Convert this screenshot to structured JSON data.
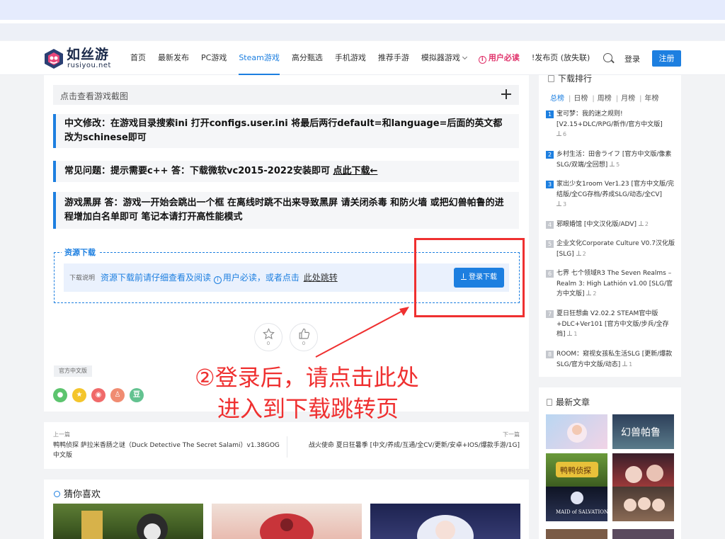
{
  "site": {
    "logo_text": "如丝游",
    "logo_sub": "rusiyou.net"
  },
  "nav": {
    "items": [
      "首页",
      "最新发布",
      "PC游戏",
      "Steam游戏",
      "高分甄选",
      "手机游戏",
      "推荐手游",
      "模拟器游戏"
    ],
    "active_index": 3,
    "notice": "用户必读",
    "publish": "!发布页 (放失联)",
    "login": "登录",
    "register": "注册"
  },
  "main": {
    "screenshot_toggle": "点击查看游戏截图",
    "notes": [
      {
        "text": "中文修改：在游戏目录搜索ini 打开configs.user.ini 将最后两行default=和language=后面的英文都改为schinese即可",
        "link": ""
      },
      {
        "text": "常见问题：提示需要c++ 答：下载微软vc2015-2022安装即可 ",
        "link": "点此下载←"
      },
      {
        "text": "游戏黑屏 答：游戏一开始会跳出一个框 在离线时跳不出来导致黑屏 请关闭杀毒 和防火墙 或把幻兽帕鲁的进程增加白名单即可 笔记本请打开高性能模式",
        "link": ""
      }
    ],
    "resource": {
      "title": "资源下载",
      "label": "下载说明",
      "text_before": "资源下载前请仔细查看及阅读",
      "notice": "用户必读",
      "text_after": "，或者点击",
      "link": "此处跳转",
      "button": "登录下载"
    },
    "reactions": {
      "star_count": "0",
      "like_count": "0"
    },
    "tag": "官方中文版",
    "share_icons": [
      "wechat-icon",
      "qzone-icon",
      "weibo-icon",
      "qq-icon",
      "douban-icon"
    ],
    "share_douban": "豆"
  },
  "annotation": {
    "line1": "②登录后，请点击此处",
    "line2": "进入到下载跳转页"
  },
  "prev_next": {
    "prev_label": "上一篇",
    "prev_title": "鸭鸭侦探 萨拉米香肠之谜（Duck Detective The Secret Salami）v1.38GOG中文版",
    "next_label": "下一篇",
    "next_title": "战火使命 夏日狂暑季 [中文/养成/互通/全CV/更新/安卓+IOS/爆款手游/1G]"
  },
  "guess": {
    "title": "猜你喜欢"
  },
  "rank": {
    "title": "下载排行",
    "tabs": [
      "总榜",
      "日榜",
      "周榜",
      "月榜",
      "年榜"
    ],
    "items": [
      {
        "num": "1",
        "title": "宝可梦：我的迷之规则! [V2.15+DLC/RPG/新作/官方中文版]",
        "count": "6"
      },
      {
        "num": "2",
        "title": "乡村生活：田舎ライフ [官方中文版/像素SLG/双端/全回想]",
        "count": "5"
      },
      {
        "num": "3",
        "title": "家出少女1room Ver1.23 [官方中文版/完结版/全CG存档/养成SLG/动态/全CV]",
        "count": "3"
      },
      {
        "num": "4",
        "title": "邪眼婚馆 [中文汉化版/ADV]",
        "count": "2"
      },
      {
        "num": "5",
        "title": "企业文化Corporate Culture V0.7汉化版 [SLG]",
        "count": "2"
      },
      {
        "num": "6",
        "title": "七界 七个领域R3 The Seven Realms – Realm 3: High Lathión v1.00 [SLG/官方中文版]",
        "count": "2"
      },
      {
        "num": "7",
        "title": "夏日狂想曲 V2.02.2 STEAM官中版+DLC+Ver101 [官方中文版/步兵/全存档]",
        "count": "1"
      },
      {
        "num": "8",
        "title": "ROOM：窥视女孩私生活SLG [更新/爆款SLG/官方中文版/动态]",
        "count": "1"
      }
    ]
  },
  "articles": {
    "title": "最新文章",
    "thumb2_text": "幻兽帕鲁",
    "thumb3_text": "鸭鸭侦探",
    "thumb5_text": "MAID of SALVATION"
  },
  "colors": {
    "accent": "#1d7fe0",
    "annotation_red": "#ef3030",
    "pink": "#e0336b"
  }
}
